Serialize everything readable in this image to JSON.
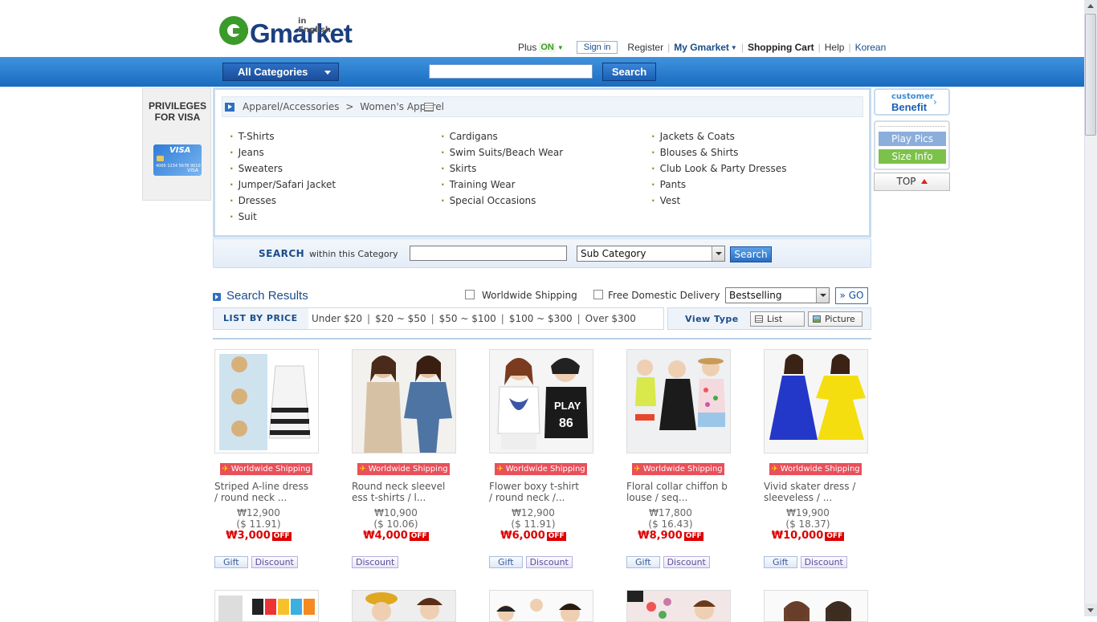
{
  "header": {
    "logo_word": "Gmarket",
    "logo_tag": "in English",
    "plus_label": "Plus",
    "plus_state": "ON",
    "sign_in": "Sign in",
    "register": "Register",
    "my_gmarket": "My Gmarket",
    "cart": "Shopping Cart",
    "help": "Help",
    "language": "Korean",
    "all_categories": "All Categories",
    "search_placeholder": "",
    "search_button": "Search"
  },
  "promo": {
    "title": "PRIVILEGES FOR VISA",
    "card_brand": "VISA",
    "card_number": "4000 1234 5678 9010"
  },
  "category": {
    "breadcrumb_root": "Apparel/Accessories",
    "breadcrumb_sep": ">",
    "breadcrumb_current": "Women's Apparel",
    "col1": [
      "T-Shirts",
      "Jeans",
      "Sweaters",
      "Jumper/Safari Jacket",
      "Dresses",
      "Suit"
    ],
    "col2": [
      "Cardigans",
      "Swim Suits/Beach Wear",
      "Skirts",
      "Training Wear",
      "Special Occasions"
    ],
    "col3": [
      "Jackets & Coats",
      "Blouses & Shirts",
      "Club Look & Party Dresses",
      "Pants",
      "Vest"
    ]
  },
  "category_search": {
    "label": "SEARCH",
    "sublabel": "within this Category",
    "input_value": "",
    "select_value": "Sub Category",
    "button": "Search"
  },
  "side": {
    "benefit_top": "customer",
    "benefit_main": "Benefit",
    "benefit_arrow": "›",
    "play_pics": "Play Pics",
    "size_info": "Size Info",
    "top": "TOP"
  },
  "results": {
    "title": "Search Results",
    "worldwide_shipping": "Worldwide Shipping",
    "free_domestic": "Free Domestic Delivery",
    "sort_value": "Bestselling",
    "go": "GO",
    "go_prefix": "»",
    "list_by_price": "LIST BY PRICE",
    "price_options": [
      "Under $20",
      "$20 ~ $50",
      "$50 ~ $100",
      "$100 ~ $300",
      "Over $300"
    ],
    "price_sep": "|",
    "view_type": "View Type",
    "view_list": "List",
    "view_picture": "Picture"
  },
  "products": [
    {
      "ws": "Worldwide Shipping",
      "name1": "Striped A-line dress",
      "name2": "/ round neck ...",
      "orig": "₩12,900",
      "usd": "($ 11.91)",
      "sale": "₩3,000",
      "off": "OFF",
      "gift": "Gift",
      "discount": "Discount"
    },
    {
      "ws": "Worldwide Shipping",
      "name1": "Round neck sleevel",
      "name2": "ess t-shirts / l...",
      "orig": "₩10,900",
      "usd": "($ 10.06)",
      "sale": "₩4,000",
      "off": "OFF",
      "gift": "",
      "discount": "Discount"
    },
    {
      "ws": "Worldwide Shipping",
      "name1": "Flower boxy t-shirt",
      "name2": "/ round neck /...",
      "orig": "₩12,900",
      "usd": "($ 11.91)",
      "sale": "₩6,000",
      "off": "OFF",
      "gift": "Gift",
      "discount": "Discount"
    },
    {
      "ws": "Worldwide Shipping",
      "name1": "Floral collar chiffon b",
      "name2": "louse / seq...",
      "orig": "₩17,800",
      "usd": "($ 16.43)",
      "sale": "₩8,900",
      "off": "OFF",
      "gift": "Gift",
      "discount": "Discount"
    },
    {
      "ws": "Worldwide Shipping",
      "name1": "Vivid skater dress /",
      "name2": "sleeveless / ...",
      "orig": "₩19,900",
      "usd": "($ 18.37)",
      "sale": "₩10,000",
      "off": "OFF",
      "gift": "Gift",
      "discount": "Discount"
    }
  ],
  "colors": {
    "brand_blue": "#1b4d8a",
    "bar_blue": "#1a6bc0",
    "sale_red": "#dd0000",
    "ws_badge": "#e8505a",
    "logo_green": "#3a9a2a"
  }
}
